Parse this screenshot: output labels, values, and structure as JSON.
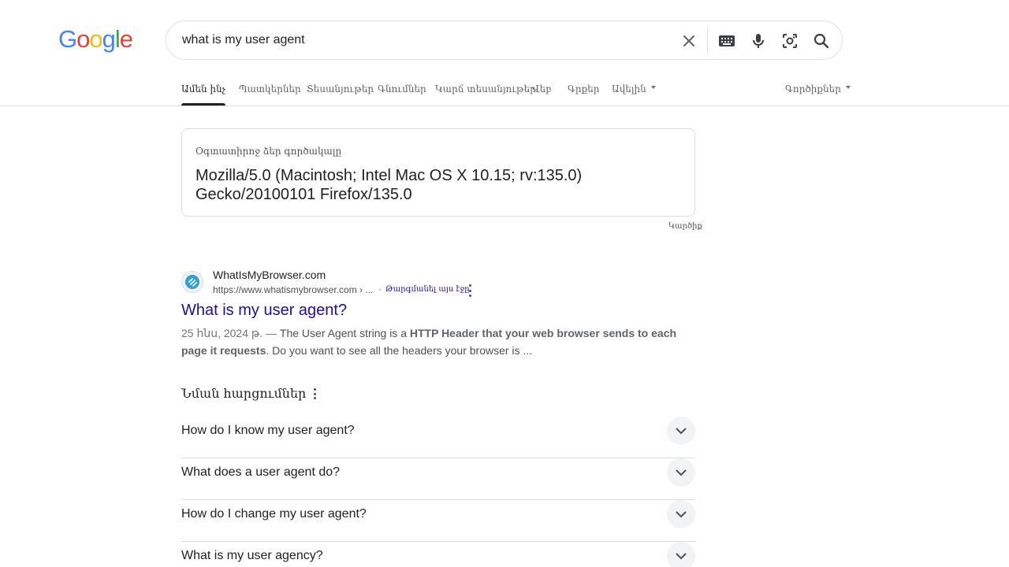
{
  "logo": {
    "text": "Google"
  },
  "search": {
    "query": "what is my user agent"
  },
  "tabs": [
    {
      "label": "Ամեն ինչ",
      "active": true
    },
    {
      "label": "Պատկերներ"
    },
    {
      "label": "Տեսանյութեր"
    },
    {
      "label": "Գնումներ"
    },
    {
      "label": "Կարճ տեսանյութեր"
    },
    {
      "label": "Վեբ"
    },
    {
      "label": "Գրքեր"
    },
    {
      "label": "Ավելին"
    }
  ],
  "tools_label": "Գործիքներ",
  "user_agent_card": {
    "label": "Օգտատիրոջ ձեր գործակալը",
    "value": "Mozilla/5.0 (Macintosh; Intel Mac OS X 10.15; rv:135.0) Gecko/20100101 Firefox/135.0",
    "feedback": "Կարծիք"
  },
  "result": {
    "site_name": "WhatIsMyBrowser.com",
    "url": "https://www.whatismybrowser.com › ...",
    "separator": "·",
    "translate": "Թարգմանել այս էջը",
    "title": "What is my user agent?",
    "date": "25 հնս, 2024 թ. — ",
    "snippet_before": "The User Agent string is a ",
    "snippet_bold": "HTTP Header that your web browser sends to each page it requests",
    "snippet_after": ". Do you want to see all the headers your browser is ..."
  },
  "paa": {
    "heading": "Նման հարցումներ",
    "questions": [
      "How do I know my user agent?",
      "What does a user agent do?",
      "How do I change my user agent?",
      "What is my user agency?"
    ]
  }
}
